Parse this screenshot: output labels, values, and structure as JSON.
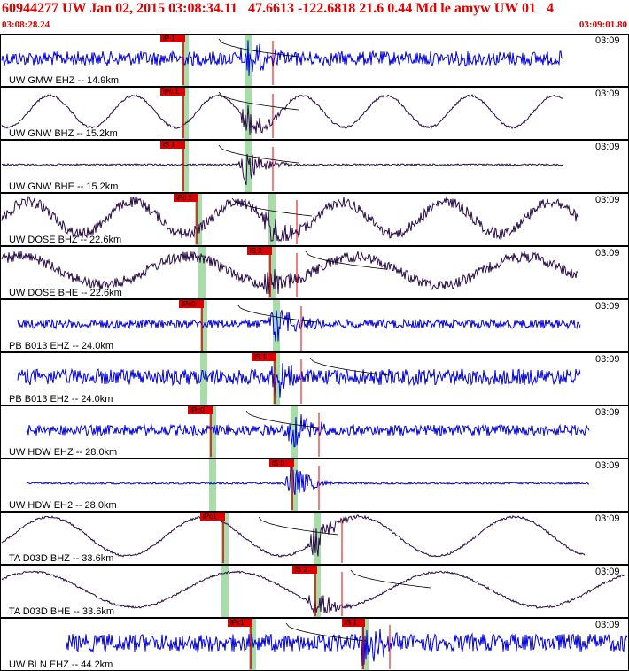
{
  "header": {
    "title": "60944277 UW Jan 02, 2015 03:08:34.11   47.6613 -122.6818 21.6 0.44 Md le amyw UW 01   4",
    "start_time": "03:08:28.24",
    "end_time": "03:09:01.80"
  },
  "colors": {
    "header_text": "#e00000",
    "trace_blue": "#0000dd",
    "trace_dark": "#2a0a4a",
    "pick_red": "#dd0000",
    "window_green": "#a8dca8",
    "border": "#000000"
  },
  "panels": [
    {
      "label": "UW GMW EHZ -- 14.9km",
      "time": "03:09",
      "pick": "iP 1",
      "trace": "blue",
      "kind": "noise"
    },
    {
      "label": "UW GNW BHZ -- 15.2km",
      "time": "03:09",
      "pick": "iPc 1",
      "trace": "dark",
      "kind": "wave"
    },
    {
      "label": "UW GNW BHE -- 15.2km",
      "time": "03:09",
      "pick": "iS 1",
      "trace": "dark",
      "kind": "flat"
    },
    {
      "label": "UW DOSE BHZ -- 22.6km",
      "time": "03:09",
      "pick": "iPc 1",
      "trace": "dark",
      "kind": "wavenoise"
    },
    {
      "label": "UW DOSE BHE -- 22.6km",
      "time": "03:09",
      "pick": "iS 2",
      "trace": "dark",
      "kind": "wavenoise"
    },
    {
      "label": "PB B013 EHZ -- 24.0km",
      "time": "03:09",
      "pick": "iPc0",
      "trace": "blue",
      "kind": "noise"
    },
    {
      "label": "PB B013 EH2 -- 24.0km",
      "time": "03:09",
      "pick": "iS 1",
      "trace": "blue",
      "kind": "noise"
    },
    {
      "label": "UW HDW EHZ -- 28.0km",
      "time": "03:09",
      "pick": "iPc0",
      "trace": "blue",
      "kind": "noise"
    },
    {
      "label": "UW HDW EH2 -- 28.0km",
      "time": "03:09",
      "pick": "iS 0",
      "trace": "blue",
      "kind": "flat"
    },
    {
      "label": "TA D03D BHZ -- 33.6km",
      "time": "03:09",
      "pick": "iPc1",
      "trace": "dark",
      "kind": "wave"
    },
    {
      "label": "TA D03D BHE -- 33.6km",
      "time": "03:09",
      "pick": "iS 2",
      "trace": "dark",
      "kind": "wave"
    },
    {
      "label": "UW BLN EHZ -- 44.2km",
      "time": "03:09",
      "pick": "iPc1",
      "trace": "blue",
      "kind": "noise"
    }
  ],
  "secondary_picks": [
    {
      "panel": 11,
      "label": "iS 1"
    }
  ]
}
